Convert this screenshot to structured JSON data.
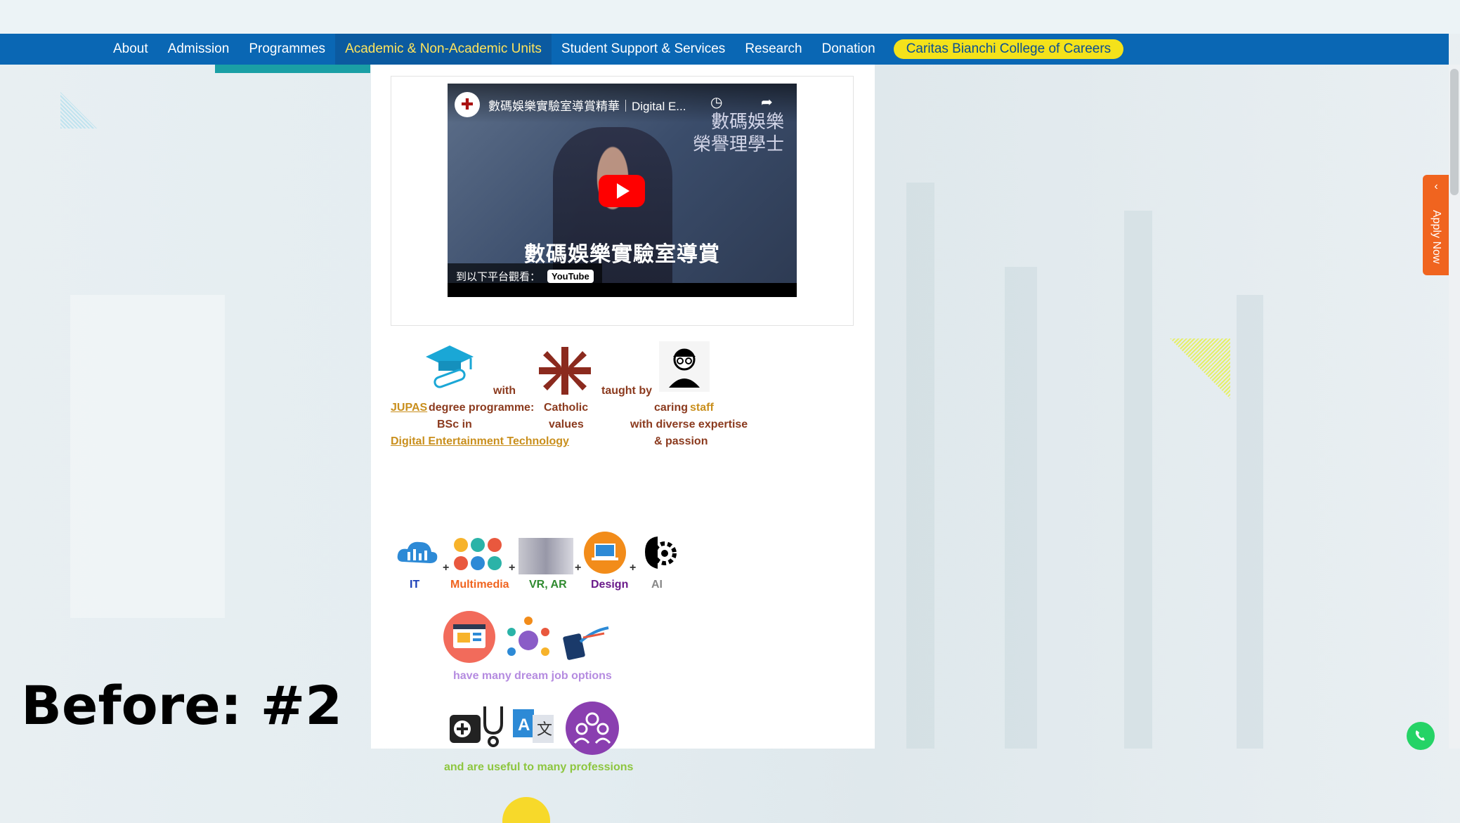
{
  "nav": {
    "items": [
      "About",
      "Admission",
      "Programmes",
      "Academic & Non-Academic Units",
      "Student Support & Services",
      "Research",
      "Donation"
    ],
    "active_index": 3,
    "pill_label": "Caritas Bianchi College of Careers"
  },
  "video": {
    "title": "數碼娛樂實驗室導賞精華｜Digital E...",
    "overlay_line1": "數碼娛樂",
    "overlay_line2": "榮譽理學士",
    "caption": "數碼娛樂實驗室導賞",
    "watch_on": "到以下平台觀看：",
    "youtube": "YouTube"
  },
  "intro": {
    "with": "with",
    "jupas": "JUPAS",
    "degree": "degree programme:",
    "bsc_in": "BSc in",
    "program_name": "Digital Entertainment Technology",
    "catholic": "Catholic",
    "values": "values",
    "taught_by": "taught by",
    "caring": "caring",
    "staff": "staff",
    "diverse": "with diverse expertise",
    "passion": "& passion"
  },
  "skills": {
    "it": "IT",
    "multimedia": "Multimedia",
    "vrar": "VR, AR",
    "design": "Design",
    "ai": "AI",
    "plus": "+"
  },
  "jobs": {
    "text": "have many dream job options"
  },
  "professions": {
    "text": "and are useful to many professions"
  },
  "apply": {
    "label": "Apply Now",
    "chevron": "‹"
  },
  "overlay": {
    "before": "Before: #2"
  },
  "colors": {
    "nav_bg": "#0a67b4",
    "nav_active_text": "#ffe45c",
    "pill_bg": "#f4e21a",
    "brown": "#8b3a1e",
    "gold": "#c98f1d",
    "apply_bg": "#f0641f"
  }
}
